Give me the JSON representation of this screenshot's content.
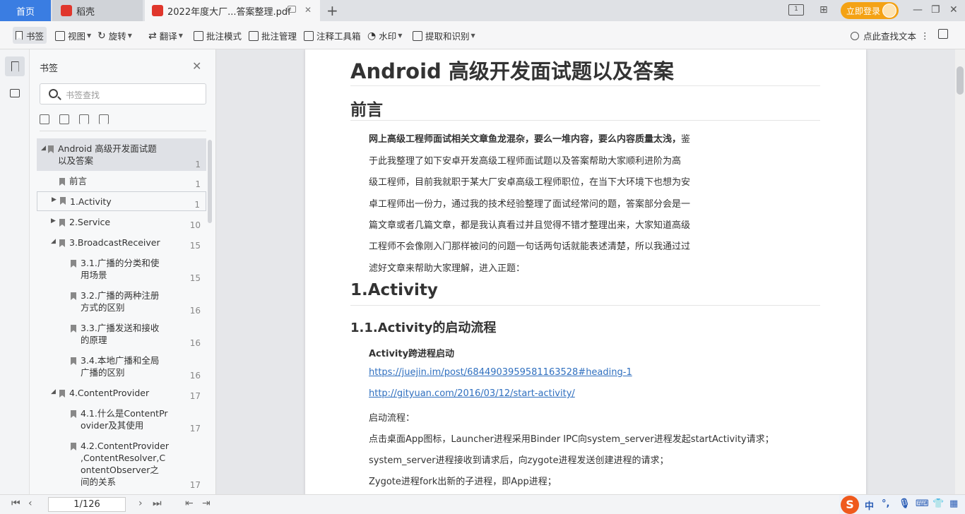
{
  "tabs": {
    "home": "首页",
    "daoke": "稻壳",
    "pdf": "2022年度大厂...答案整理.pdf",
    "login": "立即登录"
  },
  "colors": {
    "accent": "#3a7de2",
    "login": "#f4a214",
    "link": "#2f6fbf",
    "daoke_logo": "#e0362c",
    "pdf_logo": "#e0362c"
  },
  "toolbar": {
    "bookmark": "书签",
    "view": "视图",
    "rotate": "旋转",
    "translate": "翻译",
    "annotate_mode": "批注模式",
    "annotate_manage": "批注管理",
    "annotate_tools": "注释工具箱",
    "watermark": "水印",
    "extract": "提取和识别",
    "find": "点此查找文本"
  },
  "bookmarks": {
    "title": "书签",
    "search_placeholder": "书签查找",
    "items": [
      {
        "label_l1": "Android 高级开发面试题",
        "label_l2": "以及答案",
        "page": "1"
      },
      {
        "label_l1": "前言",
        "page": "1"
      },
      {
        "label_l1": "1.Activity",
        "page": "1"
      },
      {
        "label_l1": "2.Service",
        "page": "10"
      },
      {
        "label_l1": "3.BroadcastReceiver",
        "page": "15"
      },
      {
        "label_l1": "3.1.广播的分类和使",
        "label_l2": "用场景",
        "page": "15"
      },
      {
        "label_l1": "3.2.广播的两种注册",
        "label_l2": "方式的区别",
        "page": "16"
      },
      {
        "label_l1": "3.3.广播发送和接收",
        "label_l2": "的原理",
        "page": "16"
      },
      {
        "label_l1": "3.4.本地广播和全局",
        "label_l2": "广播的区别",
        "page": "16"
      },
      {
        "label_l1": "4.ContentProvider",
        "page": "17"
      },
      {
        "label_l1": "4.1.什么是ContentPr",
        "label_l2": "ovider及其使用",
        "page": "17"
      },
      {
        "label_l1": "4.2.ContentProvider",
        "label_l2": ",ContentResolver,C",
        "label_l3": "ontentObserver之",
        "label_l4": "间的关系",
        "page": "17"
      }
    ]
  },
  "document": {
    "title": "Android 高级开发面试题以及答案",
    "preface_heading": "前言",
    "preface_lines": [
      "网上高级工程师面试相关文章鱼龙混杂，要么一堆内容，要么内容质量太浅，",
      "于此我整理了如下安卓开发高级工程师面试题以及答案帮助大家顺利进阶为高",
      "级工程师，目前我就职于某大厂安卓高级工程师职位，在当下大环境下也想为安",
      "卓工程师出一份力，通过我的技术经验整理了面试经常问的题，答案部分会是一",
      "篇文章或者几篇文章，都是我认真看过并且觉得不错才整理出来，大家知道高级",
      "工程师不会像刚入门那样被问的问题一句话两句话就能表述清楚，所以我通过过",
      "滤好文章来帮助大家理解，进入正题："
    ],
    "preface_tail": "鉴",
    "section1": "1.Activity",
    "section1_1": "1.1.Activity的启动流程",
    "cross_process": "Activity跨进程启动",
    "link1": "https://juejin.im/post/6844903959581163528#heading-1",
    "link2": "http://gityuan.com/2016/03/12/start-activity/",
    "flow_label": "启动流程：",
    "flow_lines": [
      "点击桌面App图标，Launcher进程采用Binder IPC向system_server进程发起startActivity请求；",
      "system_server进程接收到请求后，向zygote进程发送创建进程的请求；",
      "Zygote进程fork出新的子进程，即App进程；"
    ]
  },
  "status": {
    "page_indicator": "1/126",
    "ime_logo": "S",
    "ime_lang": "中"
  }
}
